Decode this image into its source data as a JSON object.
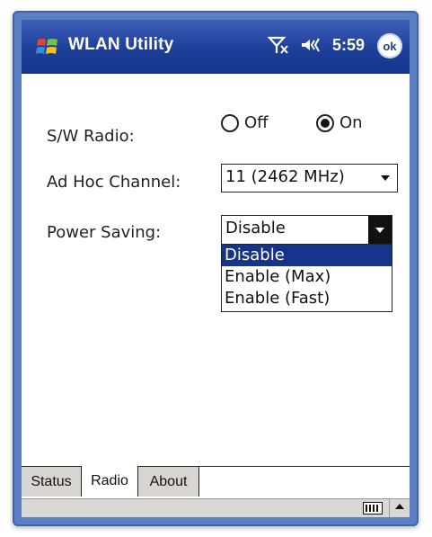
{
  "title_bar": {
    "app_title": "WLAN Utility",
    "time": "5:59",
    "ok_label": "ok",
    "icons": [
      "windows-start-icon",
      "signal-off-icon",
      "volume-icon"
    ]
  },
  "form": {
    "sw_radio": {
      "label": "S/W Radio:",
      "options": [
        {
          "label": "Off",
          "checked": false
        },
        {
          "label": "On",
          "checked": true
        }
      ]
    },
    "ad_hoc_channel": {
      "label": "Ad Hoc Channel:",
      "value": "11 (2462 MHz)"
    },
    "power_saving": {
      "label": "Power Saving:",
      "value": "Disable",
      "options": [
        "Disable",
        "Enable (Max)",
        "Enable (Fast)"
      ],
      "selected_index": 0
    }
  },
  "tabs": [
    {
      "label": "Status",
      "active": false
    },
    {
      "label": "Radio",
      "active": true
    },
    {
      "label": "About",
      "active": false
    }
  ],
  "bottom_bar": {
    "icons": [
      "keyboard-icon",
      "up-arrow-icon"
    ]
  },
  "colors": {
    "title_bar": "#1d3f99",
    "highlight": "#16358a",
    "device_frame": "#5c7fc4"
  }
}
